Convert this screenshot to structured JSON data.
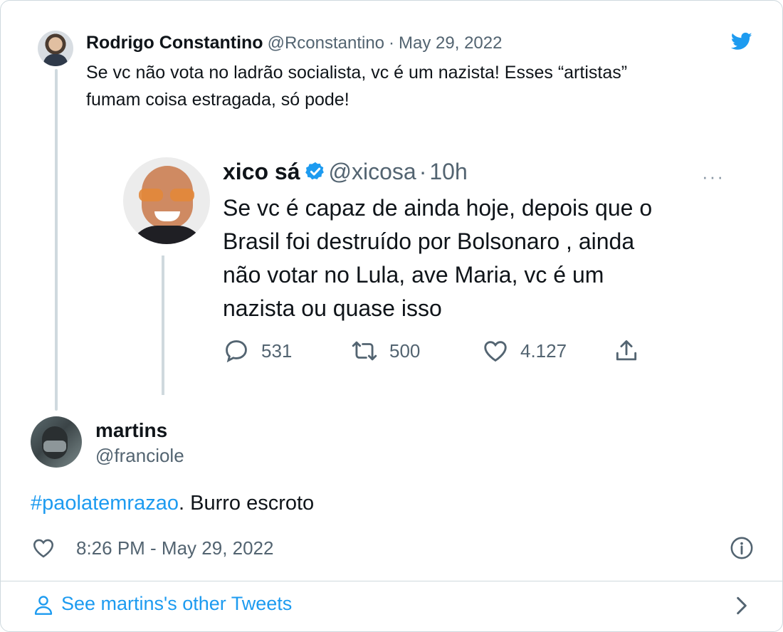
{
  "parent": {
    "author_name": "Rodrigo Constantino",
    "author_handle": "@Rconstantino",
    "separator": "·",
    "date": "May 29, 2022",
    "text_line1": "Se vc não vota no ladrão socialista, vc é um nazista! Esses “artistas”",
    "text_line2": "fumam coisa estragada, só pode!",
    "icons": {
      "platform": "twitter-bird-icon",
      "avatar": "avatar"
    }
  },
  "quoted_screenshot": {
    "author_name": "xico sá",
    "author_handle": "@xicosa",
    "separator": "·",
    "time": "10h",
    "more": "···",
    "text_lines": [
      "Se vc é capaz de ainda hoje, depois que o",
      "Brasil foi destruído por Bolsonaro , ainda",
      "não votar no Lula, ave Maria, vc é um",
      "nazista ou quase isso"
    ],
    "replies": "531",
    "retweets": "500",
    "likes": "4.127"
  },
  "reply": {
    "author_name": "martins",
    "author_handle": "@franciole",
    "hashtag": "#paolatemrazao",
    "text_rest": ". Burro escroto",
    "timestamp": "8:26 PM - May 29, 2022"
  },
  "footer": {
    "link_text": "See martins's other Tweets"
  },
  "colors": {
    "accent": "#1d9bf0",
    "text": "#0f1419",
    "secondary": "#536471",
    "border": "#cfd9de"
  }
}
